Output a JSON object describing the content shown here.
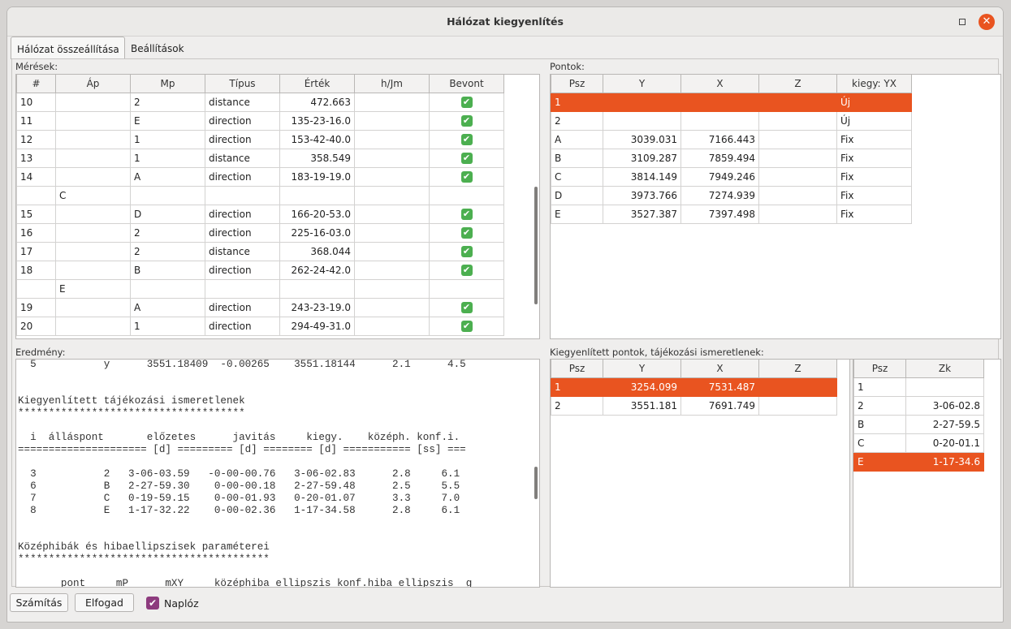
{
  "window": {
    "title": "Hálózat kiegyenlítés",
    "close_symbol": "✕"
  },
  "tabs": [
    {
      "label": "Hálózat összeállítása",
      "active": true
    },
    {
      "label": "Beállítások",
      "active": false
    }
  ],
  "measurements": {
    "label": "Mérések:",
    "columns": [
      "#",
      "Áp",
      "Mp",
      "Típus",
      "Érték",
      "h/Jm",
      "Bevont"
    ],
    "rows": [
      {
        "n": "10",
        "ap": "",
        "mp": "2",
        "type": "distance",
        "value": "472.663",
        "hjm": "",
        "on": true
      },
      {
        "n": "11",
        "ap": "",
        "mp": "E",
        "type": "direction",
        "value": "135-23-16.0",
        "hjm": "",
        "on": true
      },
      {
        "n": "12",
        "ap": "",
        "mp": "1",
        "type": "direction",
        "value": "153-42-40.0",
        "hjm": "",
        "on": true
      },
      {
        "n": "13",
        "ap": "",
        "mp": "1",
        "type": "distance",
        "value": "358.549",
        "hjm": "",
        "on": true
      },
      {
        "n": "14",
        "ap": "",
        "mp": "A",
        "type": "direction",
        "value": "183-19-19.0",
        "hjm": "",
        "on": true
      },
      {
        "n": "",
        "ap": "C",
        "mp": "",
        "type": "",
        "value": "",
        "hjm": "",
        "on": false
      },
      {
        "n": "15",
        "ap": "",
        "mp": "D",
        "type": "direction",
        "value": "166-20-53.0",
        "hjm": "",
        "on": true
      },
      {
        "n": "16",
        "ap": "",
        "mp": "2",
        "type": "direction",
        "value": "225-16-03.0",
        "hjm": "",
        "on": true
      },
      {
        "n": "17",
        "ap": "",
        "mp": "2",
        "type": "distance",
        "value": "368.044",
        "hjm": "",
        "on": true
      },
      {
        "n": "18",
        "ap": "",
        "mp": "B",
        "type": "direction",
        "value": "262-24-42.0",
        "hjm": "",
        "on": true
      },
      {
        "n": "",
        "ap": "E",
        "mp": "",
        "type": "",
        "value": "",
        "hjm": "",
        "on": false
      },
      {
        "n": "19",
        "ap": "",
        "mp": "A",
        "type": "direction",
        "value": "243-23-19.0",
        "hjm": "",
        "on": true
      },
      {
        "n": "20",
        "ap": "",
        "mp": "1",
        "type": "direction",
        "value": "294-49-31.0",
        "hjm": "",
        "on": true
      }
    ]
  },
  "points": {
    "label": "Pontok:",
    "columns": [
      "Psz",
      "Y",
      "X",
      "Z",
      "kiegy: YX"
    ],
    "rows": [
      {
        "psz": "1",
        "y": "",
        "x": "",
        "z": "",
        "k": "Új",
        "selected": true
      },
      {
        "psz": "2",
        "y": "",
        "x": "",
        "z": "",
        "k": "Új",
        "selected": false
      },
      {
        "psz": "A",
        "y": "3039.031",
        "x": "7166.443",
        "z": "",
        "k": "Fix",
        "selected": false
      },
      {
        "psz": "B",
        "y": "3109.287",
        "x": "7859.494",
        "z": "",
        "k": "Fix",
        "selected": false
      },
      {
        "psz": "C",
        "y": "3814.149",
        "x": "7949.246",
        "z": "",
        "k": "Fix",
        "selected": false
      },
      {
        "psz": "D",
        "y": "3973.766",
        "x": "7274.939",
        "z": "",
        "k": "Fix",
        "selected": false
      },
      {
        "psz": "E",
        "y": "3527.387",
        "x": "7397.498",
        "z": "",
        "k": "Fix",
        "selected": false
      }
    ]
  },
  "result": {
    "label": "Eredmény:",
    "lines": [
      "  5           y      3551.18409  -0.00265    3551.18144      2.1      4.5",
      "",
      "",
      "Kiegyenlített tájékozási ismeretlenek",
      "*************************************",
      "",
      "  i  álláspont       előzetes      javitás     kiegy.    középh. konf.i.",
      "===================== [d] ========= [d] ======== [d] =========== [ss] ===",
      "",
      "  3           2   3-06-03.59   -0-00-00.76   3-06-02.83      2.8     6.1",
      "  6           B   2-27-59.30    0-00-00.18   2-27-59.48      2.5     5.5",
      "  7           C   0-19-59.15    0-00-01.93   0-20-01.07      3.3     7.0",
      "  8           E   1-17-32.22    0-00-02.36   1-17-34.58      2.8     6.1",
      "",
      "",
      "Középhibák és hibaellipszisek paraméterei",
      "*****************************************",
      "",
      "       pont     mP      mXY     középhiba ellipszis konf.hiba ellipszis  g"
    ]
  },
  "adjusted": {
    "label": "Kiegyenlített pontok, tájékozási ismeretlenek:",
    "columns": [
      "Psz",
      "Y",
      "X",
      "Z"
    ],
    "rows": [
      {
        "psz": "1",
        "y": "3254.099",
        "x": "7531.487",
        "z": "",
        "selected": true
      },
      {
        "psz": "2",
        "y": "3551.181",
        "x": "7691.749",
        "z": "",
        "selected": false
      }
    ]
  },
  "orientation": {
    "columns": [
      "Psz",
      "Zk"
    ],
    "rows": [
      {
        "psz": "1",
        "zk": "",
        "selected": false
      },
      {
        "psz": "2",
        "zk": "3-06-02.8",
        "selected": false
      },
      {
        "psz": "B",
        "zk": "2-27-59.5",
        "selected": false
      },
      {
        "psz": "C",
        "zk": "0-20-01.1",
        "selected": false
      },
      {
        "psz": "E",
        "zk": "1-17-34.6",
        "selected": true
      }
    ]
  },
  "buttons": {
    "compute": "Számítás",
    "accept": "Elfogad",
    "log_label": "Naplóz",
    "log_checked": true,
    "check_symbol": "✔"
  },
  "colors": {
    "selection": "#e95420",
    "checkbox": "#8d3b7e",
    "check_green": "#4caf50"
  }
}
